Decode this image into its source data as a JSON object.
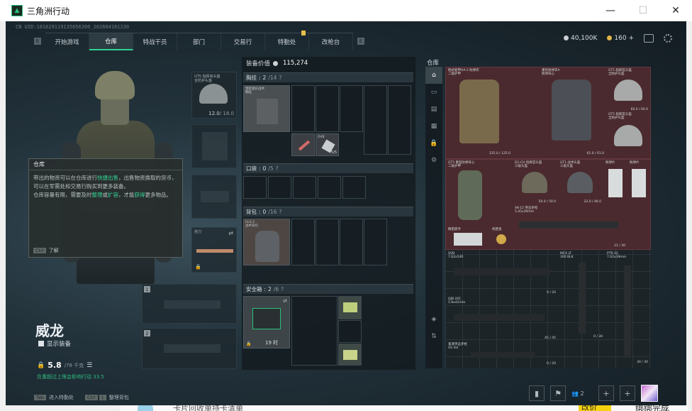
{
  "window": {
    "title": "三角洲行动",
    "controls": [
      "—",
      "☐",
      "✕"
    ]
  },
  "uid": "CN UID:101629119135656200_202604161230",
  "nav": {
    "left_key": "E",
    "right_key": "E",
    "tabs": [
      {
        "label": "开始游戏"
      },
      {
        "label": "仓库"
      },
      {
        "label": "特战干员"
      },
      {
        "label": "部门"
      },
      {
        "label": "交易行"
      },
      {
        "label": "特勤处"
      },
      {
        "label": "改枪台"
      }
    ],
    "active_tab": "仓库"
  },
  "currency": {
    "havoc": "40,100K",
    "coupon": "160",
    "plus": "+"
  },
  "tooltip": {
    "title": "仓库",
    "p1_a": "带出的物资可以在仓库进行",
    "p1_b": "快捷出售",
    "p1_c": "，出售物资换取的货币，可以在军需处和交易行购买到更多装备。",
    "p2_a": "仓库容量有限，需要及时",
    "p2_b": "整理",
    "p2_c": "或",
    "p2_d": "扩容",
    "p2_e": "，才能",
    "p2_f": "获得",
    "p2_g": "更多物品。",
    "key": "Ctrl",
    "action": "了解"
  },
  "operator": {
    "name": "威龙",
    "show_equipment": "显示装备",
    "weight": "5.8",
    "weight_limit": "/78 千克",
    "weight_note": "负重超过上限会影响行动",
    "weight_val2": "33.5"
  },
  "equip_slots": {
    "helmet_label": "GT5 指挥官头盔\n全防护头盔",
    "helmet_durability": "12.0",
    "helmet_max": "/ 18.0",
    "melee_label": "挂刀",
    "slot1": "1",
    "slot2": "2"
  },
  "bag": {
    "value_label": "装备价值",
    "value": "115,274",
    "sections": [
      {
        "title": "胸挂",
        "count": "2",
        "cap": "/14"
      },
      {
        "title": "口袋",
        "count": "0",
        "cap": "/5"
      },
      {
        "title": "背包",
        "count": "0",
        "cap": "/16"
      },
      {
        "title": "安全箱",
        "count": "2",
        "cap": "/6"
      }
    ],
    "rig_item": "预装迷彩战术\n胸挂",
    "ovb_label": "OVB",
    "ovb_count": "5/5",
    "backpack_item": "HLS-2\n战术背包",
    "secure_time": "19 时"
  },
  "stash": {
    "title": "仓库",
    "items": [
      {
        "name": "制式套甲HA-2 防弹衣\n二级护甲",
        "foot": "125.0 / 125.0"
      },
      {
        "name": "重装防弹衣A\n防弹背心",
        "foot": "61.0 / 61.0"
      },
      {
        "name": "GT5 指挥官头盔\n全防护头盔",
        "foot": "60.0 / 60.0"
      },
      {
        "name": "GT5 指挥官头盔\n全防护头盔",
        "foot": ""
      },
      {
        "name": "GT5 重型防弹背心\n二级护甲",
        "foot": ""
      },
      {
        "name": "D1-CH 指挥官头盔\n三级头盔",
        "foot": "50.0 / 50.0"
      },
      {
        "name": "GT1 战术头盔\n三级头盔",
        "foot": "22.0 / 46.0"
      },
      {
        "name": "防弹片",
        "foot": ""
      },
      {
        "name": "防弹片",
        "foot": ""
      },
      {
        "name": "精密扳手",
        "foot": ""
      },
      {
        "name": "机匣盖",
        "foot": ""
      },
      {
        "name": "AK-12 突击步枪\n5.45x39mm",
        "foot": "21 / 30"
      },
      {
        "name": "SVD\n7.62x54R",
        "foot": "0 / 20"
      },
      {
        "name": "MCX LT\n300 BLK",
        "foot": ""
      },
      {
        "name": "PTR-32\n7.62x39mm",
        "foot": ""
      },
      {
        "name": "QJB-201\n5.8x42mm",
        "foot": "45 / 45"
      },
      {
        "name": "紧凑突击步枪\nAS Val",
        "foot": ""
      },
      {
        "name": "",
        "foot": "0 / 30"
      },
      {
        "name": "",
        "foot": "0 / 20"
      },
      {
        "name": "",
        "foot": "30 / 30"
      }
    ]
  },
  "bottom": {
    "tab_key": "Tab",
    "tab_action": "进入特勤处",
    "ctrl_key": "Ctrl",
    "ctrl_num": "1",
    "ctrl_action": "整理背包",
    "friends_count": "2"
  },
  "taskbar": {
    "text_a": "卡片回收单持卡清单",
    "text_b": "改价",
    "text_c": "绑绑完成"
  }
}
